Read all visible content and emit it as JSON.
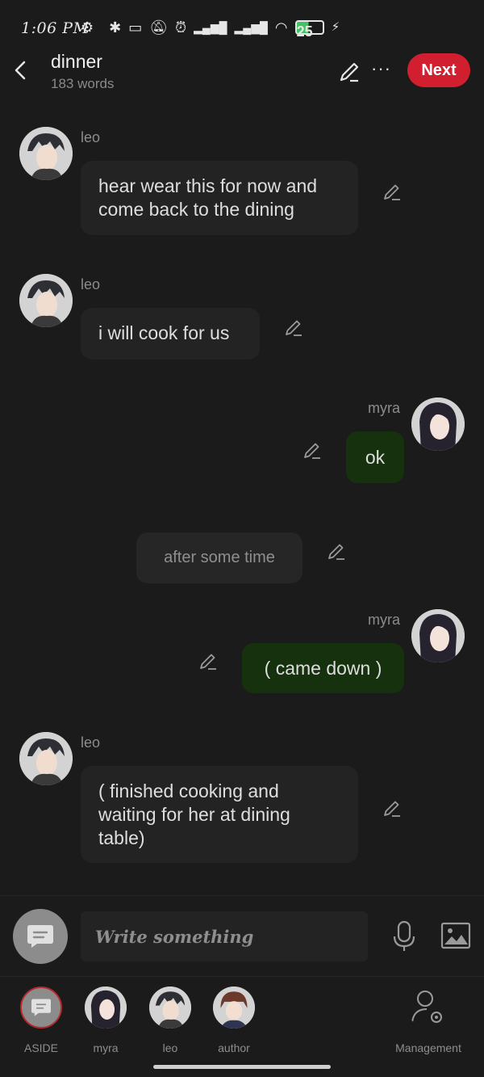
{
  "status_bar": {
    "time": "1:06 PM",
    "battery": "25"
  },
  "header": {
    "title": "dinner",
    "word_count": "183 words",
    "next_label": "Next",
    "more_label": "···"
  },
  "messages": [
    {
      "speaker": "leo",
      "text": "hear wear this for now and come back to the dining"
    },
    {
      "speaker": "leo",
      "text": "i will cook for us"
    },
    {
      "speaker": "myra",
      "text": "ok"
    },
    {
      "speaker": "",
      "text": "after some time"
    },
    {
      "speaker": "myra",
      "text": "( came down )"
    },
    {
      "speaker": "leo",
      "text": "( finished cooking and waiting for her at dining table)"
    }
  ],
  "composer": {
    "placeholder": "Write something"
  },
  "tabs": [
    {
      "label": "ASIDE"
    },
    {
      "label": "myra"
    },
    {
      "label": "leo"
    },
    {
      "label": "author"
    },
    {
      "label": "Management"
    }
  ],
  "colors": {
    "accent": "#d11f2f",
    "my_bubble": "#16310d",
    "other_bubble": "#232323",
    "background": "#1b1b1b"
  }
}
